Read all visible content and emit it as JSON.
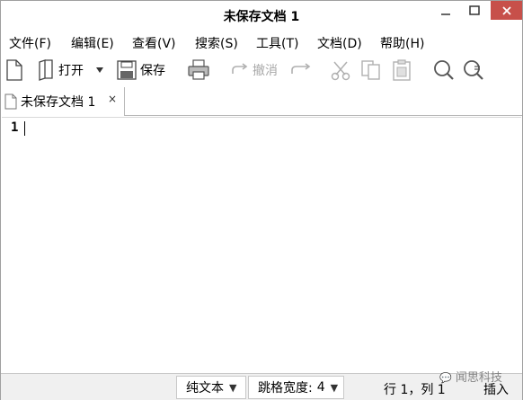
{
  "window": {
    "title": "未保存文档 1"
  },
  "menubar": {
    "items": [
      {
        "label": "文件(F)"
      },
      {
        "label": "编辑(E)"
      },
      {
        "label": "查看(V)"
      },
      {
        "label": "搜索(S)"
      },
      {
        "label": "工具(T)"
      },
      {
        "label": "文档(D)"
      },
      {
        "label": "帮助(H)"
      }
    ]
  },
  "toolbar": {
    "new_icon": "new-document-icon",
    "open_label": "打开",
    "save_label": "保存",
    "print_icon": "printer-icon",
    "undo_label": "撤消",
    "redo_icon": "redo-icon",
    "cut_icon": "scissors-icon",
    "copy_icon": "copy-icon",
    "paste_icon": "paste-icon",
    "search_icon": "search-icon",
    "replace_icon": "search-replace-icon",
    "disabled_color": "#a8a8a8"
  },
  "tabs": [
    {
      "label": "未保存文档 1",
      "close": "×",
      "active": true
    }
  ],
  "editor": {
    "line_numbers": [
      "1"
    ],
    "content": ""
  },
  "statusbar": {
    "language": "纯文本",
    "tab_width_label": "跳格宽度:",
    "tab_width_value": "4",
    "cursor_position": "行 1，列 1",
    "insert_mode": "插入"
  },
  "watermark": {
    "text": "闻思科技"
  },
  "colors": {
    "close_button": "#c7504a",
    "border": "#a0a0a0",
    "statusbar_bg": "#f0f0f0"
  }
}
